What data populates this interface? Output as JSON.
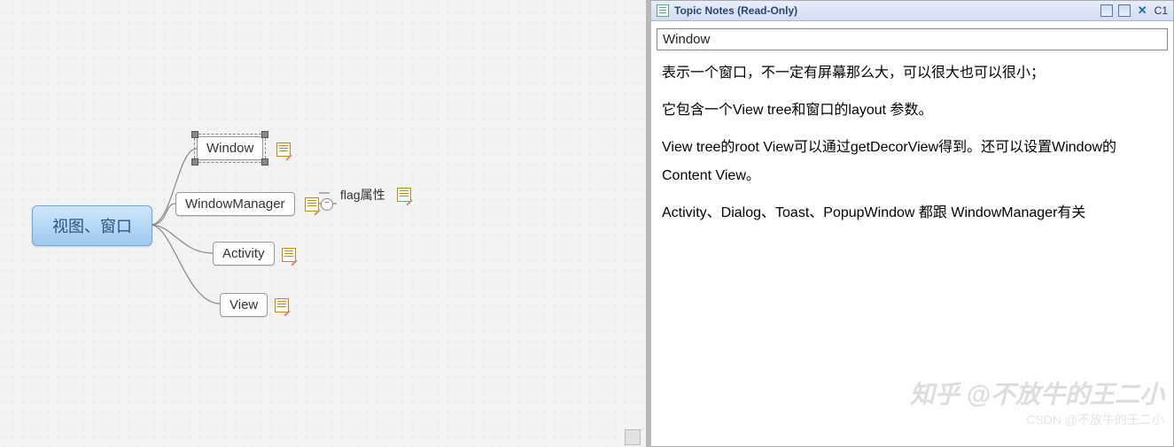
{
  "mindmap": {
    "root": "视图、窗口",
    "children": [
      {
        "label": "Window",
        "has_note": true,
        "selected": true
      },
      {
        "label": "WindowManager",
        "has_note": true,
        "children": [
          {
            "label": "flag属性",
            "has_note": true
          }
        ]
      },
      {
        "label": "Activity",
        "has_note": true
      },
      {
        "label": "View",
        "has_note": true
      }
    ]
  },
  "notes_panel": {
    "header_title": "Topic Notes (Read-Only)",
    "header_right": "C1",
    "current_topic": "Window",
    "body": [
      "表示一个窗口，不一定有屏幕那么大，可以很大也可以很小；",
      "它包含一个View tree和窗口的layout 参数。",
      "View tree的root View可以通过getDecorView得到。还可以设置Window的Content View。",
      "",
      "Activity、Dialog、Toast、PopupWindow 都跟 WindowManager有关"
    ]
  },
  "watermark": {
    "line1": "知乎 @不放牛的王二小",
    "line2": "CSDN @不放牛的王二小"
  }
}
